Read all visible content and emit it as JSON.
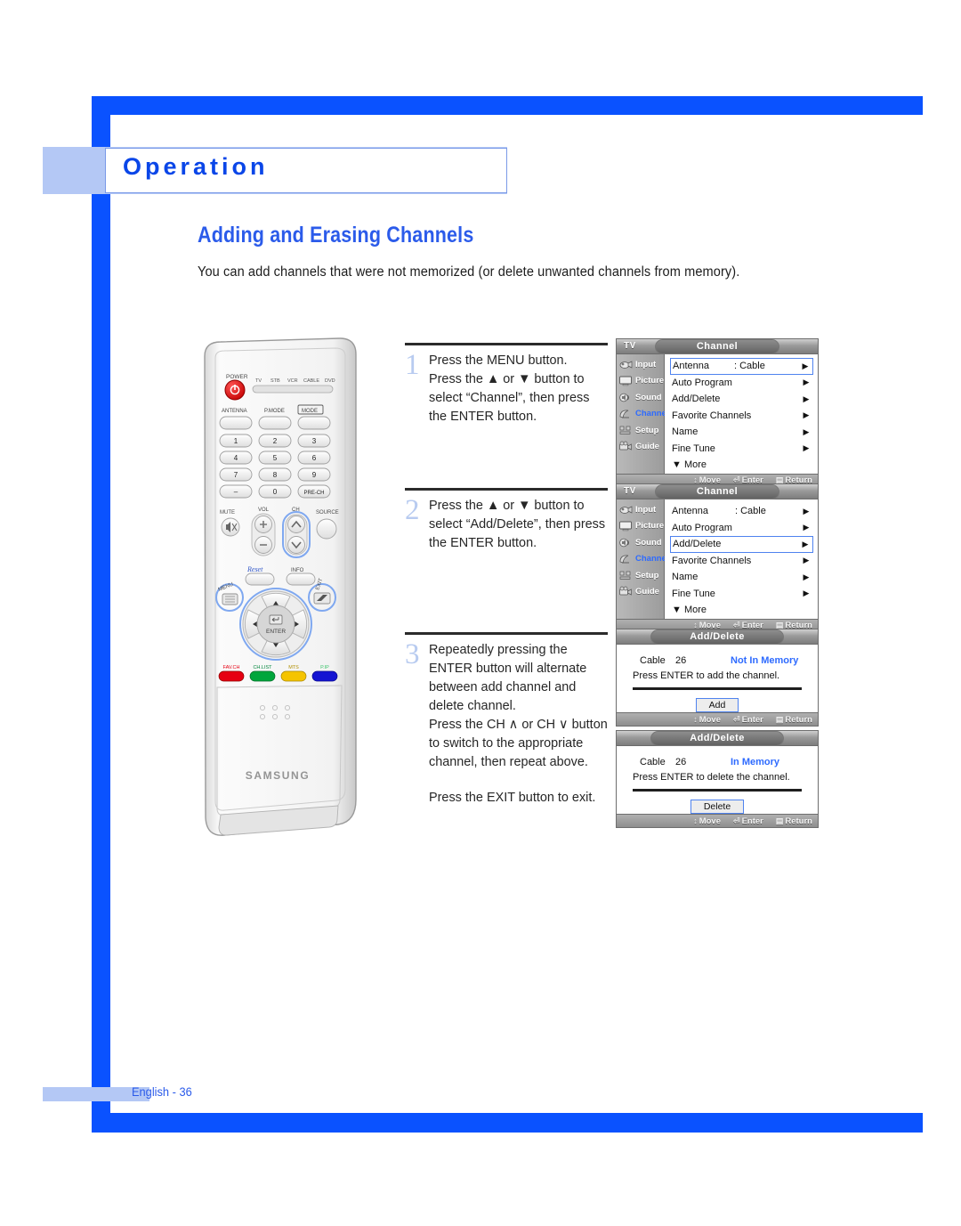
{
  "page": {
    "banner_title": "Operation",
    "section_title": "Adding and Erasing Channels",
    "intro": "You can add channels that were not memorized (or delete unwanted channels from memory).",
    "footer": "English - 36",
    "accent_blue": "#0a52ff",
    "light_blue": "#b4c8f5",
    "heading_blue": "#2b5bea"
  },
  "steps": [
    {
      "number": "1",
      "text": "Press the MENU button.\nPress the ▲ or ▼ button to select “Channel”, then press the ENTER button."
    },
    {
      "number": "2",
      "text": "Press the ▲ or ▼ button to select “Add/Delete”, then press the ENTER button."
    },
    {
      "number": "3",
      "text": "Repeatedly pressing the ENTER button will alternate between add channel and delete channel.\nPress the CH ∧ or CH ∨ button to switch to the appropriate channel, then repeat above.",
      "extra": "Press the EXIT button to exit."
    }
  ],
  "osd_menus": [
    {
      "tv_label": "TV",
      "title": "Channel",
      "sidebar": [
        {
          "label": "Input",
          "icon": "camera-icon",
          "active": false
        },
        {
          "label": "Picture",
          "icon": "monitor-icon",
          "active": false
        },
        {
          "label": "Sound",
          "icon": "speaker-icon",
          "active": false
        },
        {
          "label": "Channel",
          "icon": "satellite-dish-icon",
          "active": true
        },
        {
          "label": "Setup",
          "icon": "tools-icon",
          "active": false
        },
        {
          "label": "Guide",
          "icon": "film-icon",
          "active": false
        }
      ],
      "rows": [
        {
          "label": "Antenna",
          "value": ": Cable",
          "arrow": "▶",
          "selected": true
        },
        {
          "label": "Auto Program",
          "value": "",
          "arrow": "▶",
          "selected": false
        },
        {
          "label": "Add/Delete",
          "value": "",
          "arrow": "▶",
          "selected": false
        },
        {
          "label": "Favorite Channels",
          "value": "",
          "arrow": "▶",
          "selected": false
        },
        {
          "label": "Name",
          "value": "",
          "arrow": "▶",
          "selected": false
        },
        {
          "label": "Fine Tune",
          "value": "",
          "arrow": "▶",
          "selected": false
        }
      ],
      "more": "▼ More",
      "footer": [
        {
          "glyph": "↕",
          "label": "Move"
        },
        {
          "glyph": "⏎",
          "label": "Enter"
        },
        {
          "glyph": "▤",
          "label": "Return"
        }
      ]
    },
    {
      "tv_label": "TV",
      "title": "Channel",
      "sidebar": [
        {
          "label": "Input",
          "icon": "camera-icon",
          "active": false
        },
        {
          "label": "Picture",
          "icon": "monitor-icon",
          "active": false
        },
        {
          "label": "Sound",
          "icon": "speaker-icon",
          "active": false
        },
        {
          "label": "Channel",
          "icon": "satellite-dish-icon",
          "active": true
        },
        {
          "label": "Setup",
          "icon": "tools-icon",
          "active": false
        },
        {
          "label": "Guide",
          "icon": "film-icon",
          "active": false
        }
      ],
      "rows": [
        {
          "label": "Antenna",
          "value": ": Cable",
          "arrow": "▶",
          "selected": false
        },
        {
          "label": "Auto Program",
          "value": "",
          "arrow": "▶",
          "selected": false
        },
        {
          "label": "Add/Delete",
          "value": "",
          "arrow": "▶",
          "selected": true
        },
        {
          "label": "Favorite Channels",
          "value": "",
          "arrow": "▶",
          "selected": false
        },
        {
          "label": "Name",
          "value": "",
          "arrow": "▶",
          "selected": false
        },
        {
          "label": "Fine Tune",
          "value": "",
          "arrow": "▶",
          "selected": false
        }
      ],
      "more": "▼ More",
      "footer": [
        {
          "glyph": "↕",
          "label": "Move"
        },
        {
          "glyph": "⏎",
          "label": "Enter"
        },
        {
          "glyph": "▤",
          "label": "Return"
        }
      ]
    }
  ],
  "osd_dialogs": [
    {
      "title": "Add/Delete",
      "channel_label": "Cable",
      "channel_number": "26",
      "status": "Not In Memory",
      "instruction": "Press ENTER to add the channel.",
      "button": "Add",
      "footer": [
        {
          "glyph": "↕",
          "label": "Move"
        },
        {
          "glyph": "⏎",
          "label": "Enter"
        },
        {
          "glyph": "▤",
          "label": "Return"
        }
      ]
    },
    {
      "title": "Add/Delete",
      "channel_label": "Cable",
      "channel_number": "26",
      "status": "In Memory",
      "instruction": "Press ENTER to delete the channel.",
      "button": "Delete",
      "footer": [
        {
          "glyph": "↕",
          "label": "Move"
        },
        {
          "glyph": "⏎",
          "label": "Enter"
        },
        {
          "glyph": "▤",
          "label": "Return"
        }
      ]
    }
  ],
  "remote": {
    "brand": "SAMSUNG",
    "power_label": "POWER",
    "device_labels": [
      "TV",
      "STB",
      "VCR",
      "CABLE",
      "DVD"
    ],
    "row_labels": [
      "ANTENNA",
      "P.MODE",
      "MODE"
    ],
    "keypad": [
      "1",
      "2",
      "3",
      "4",
      "5",
      "6",
      "7",
      "8",
      "9",
      "–",
      "0",
      "PRE-CH"
    ],
    "vol_label": "VOL",
    "ch_label": "CH",
    "mute_label": "MUTE",
    "source_label": "SOURCE",
    "info_label": "INFO",
    "menu_label": "MENU",
    "exit_label": "EXIT",
    "enter_label": "ENTER",
    "reset_label": "Reset",
    "color_buttons": [
      {
        "label": "FAV.CH",
        "color": "#e60012"
      },
      {
        "label": "CH.LIST",
        "color": "#00a63c"
      },
      {
        "label": "MTS",
        "color": "#f5c400"
      },
      {
        "label": "P.IP",
        "color": "#1414d2"
      }
    ]
  }
}
